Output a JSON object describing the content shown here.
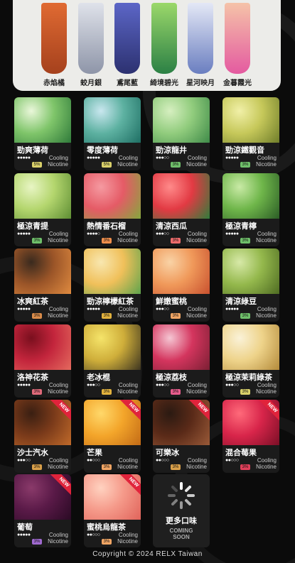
{
  "devices": [
    {
      "name": "赤焰橘",
      "colors": [
        "#e06a32",
        "#a5411d"
      ]
    },
    {
      "name": "蛟月銀",
      "colors": [
        "#dfe2ea",
        "#8e95a8"
      ]
    },
    {
      "name": "鳶尾藍",
      "colors": [
        "#5c66c7",
        "#2c3170"
      ]
    },
    {
      "name": "綺境碧光",
      "colors": [
        "#9bd86a",
        "#2b8045"
      ]
    },
    {
      "name": "星河映月",
      "colors": [
        "#e4e8f6",
        "#6a7ec0"
      ]
    },
    {
      "name": "金暮霞光",
      "colors": [
        "#f5c3a8",
        "#e45aa0"
      ]
    }
  ],
  "cooling_label": "Cooling",
  "nicotine_label": "Nicotine",
  "new_badge": "NEW",
  "flavors": [
    {
      "name": "勁爽薄荷",
      "cooling": 5,
      "nicotine": "5%",
      "pct_color": "#d9d06a",
      "img": [
        "#eaf7da",
        "#7fc56a",
        "#2f7a3a"
      ],
      "new": false
    },
    {
      "name": "零度薄荷",
      "cooling": 5,
      "nicotine": "5%",
      "pct_color": "#d9d06a",
      "img": [
        "#c9e7ef",
        "#5db1a1",
        "#1e6e63"
      ],
      "new": false
    },
    {
      "name": "勁涼龍井",
      "cooling": 3,
      "nicotine": "3%",
      "pct_color": "#6fbf6a",
      "img": [
        "#d6efc0",
        "#91cc7d",
        "#3e8a48"
      ],
      "new": false
    },
    {
      "name": "勁涼鐵觀音",
      "cooling": 5,
      "nicotine": "3%",
      "pct_color": "#6fbf6a",
      "img": [
        "#f1f0a8",
        "#c6c85a",
        "#6f7d2a"
      ],
      "new": false
    },
    {
      "name": "極涼青提",
      "cooling": 5,
      "nicotine": "3%",
      "pct_color": "#6fbf6a",
      "img": [
        "#e8f5c4",
        "#b4d66e",
        "#5d8d33"
      ],
      "new": false
    },
    {
      "name": "熱情番石榴",
      "cooling": 4,
      "nicotine": "3%",
      "pct_color": "#f08f4c",
      "img": [
        "#f59aa1",
        "#e55b66",
        "#84a83d"
      ],
      "new": false
    },
    {
      "name": "清涼西瓜",
      "cooling": 3,
      "nicotine": "3%",
      "pct_color": "#ef6c6c",
      "img": [
        "#ff8a8a",
        "#e23a43",
        "#2f7d3b"
      ],
      "new": false
    },
    {
      "name": "極涼青檸",
      "cooling": 5,
      "nicotine": "3%",
      "pct_color": "#6fbf6a",
      "img": [
        "#c9eaa6",
        "#6fb64a",
        "#2b5c26"
      ],
      "new": false
    },
    {
      "name": "冰爽紅茶",
      "cooling": 5,
      "nicotine": "3%",
      "pct_color": "#d98c4a",
      "img": [
        "#3a2a1e",
        "#9b5528",
        "#e08b40"
      ],
      "new": false
    },
    {
      "name": "勁涼檸檬紅茶",
      "cooling": 5,
      "nicotine": "3%",
      "pct_color": "#e2b23e",
      "img": [
        "#f8e7b0",
        "#f0c05a",
        "#5da34c"
      ],
      "new": false
    },
    {
      "name": "鮮嫩蜜桃",
      "cooling": 3,
      "nicotine": "3%",
      "pct_color": "#f0a564",
      "img": [
        "#f9d3a6",
        "#f0995a",
        "#c8502e"
      ],
      "new": false
    },
    {
      "name": "清涼綠豆",
      "cooling": 5,
      "nicotine": "3%",
      "pct_color": "#6fbf6a",
      "img": [
        "#d7e9a8",
        "#94b84c",
        "#4e6b22"
      ],
      "new": false
    },
    {
      "name": "洛神花茶",
      "cooling": 5,
      "nicotine": "3%",
      "pct_color": "#e06a7a",
      "img": [
        "#7a0f1e",
        "#c3253c",
        "#e46a5e"
      ],
      "new": false
    },
    {
      "name": "老冰棍",
      "cooling": 3,
      "nicotine": "3%",
      "pct_color": "#e2b23e",
      "img": [
        "#f5e46a",
        "#cfae3a",
        "#3c3420"
      ],
      "new": false
    },
    {
      "name": "極涼荔枝",
      "cooling": 3,
      "nicotine": "3%",
      "pct_color": "#e85c8c",
      "img": [
        "#f5c6d3",
        "#d4355e",
        "#7a1f33"
      ],
      "new": false
    },
    {
      "name": "極涼茉莉綠茶",
      "cooling": 3,
      "nicotine": "3%",
      "pct_color": "#d9d06a",
      "img": [
        "#faf2d8",
        "#eed38a",
        "#b38a3a"
      ],
      "new": false
    },
    {
      "name": "沙士汽水",
      "cooling": 3,
      "nicotine": "3%",
      "pct_color": "#d9a04a",
      "img": [
        "#3a1f12",
        "#7a3a1a",
        "#c06a2a"
      ],
      "new": true
    },
    {
      "name": "芒果",
      "cooling": 2,
      "nicotine": "3%",
      "pct_color": "#f0a564",
      "img": [
        "#ffd86a",
        "#f3a52a",
        "#c26a16"
      ],
      "new": true
    },
    {
      "name": "可樂冰",
      "cooling": 2,
      "nicotine": "3%",
      "pct_color": "#d9a04a",
      "img": [
        "#2b1a12",
        "#5a2a18",
        "#9a5a38"
      ],
      "new": true
    },
    {
      "name": "混合莓果",
      "cooling": 2,
      "nicotine": "3%",
      "pct_color": "#e0405a",
      "img": [
        "#ff6a7a",
        "#d8254a",
        "#7a0f26"
      ],
      "new": true
    },
    {
      "name": "葡萄",
      "cooling": 5,
      "nicotine": "3%",
      "pct_color": "#a06ad0",
      "img": [
        "#8a3a6a",
        "#5a1a48",
        "#2a0a24"
      ],
      "new": true
    },
    {
      "name": "蜜桃烏龍茶",
      "cooling": 2,
      "nicotine": "3%",
      "pct_color": "#f0a564",
      "img": [
        "#ffd2c0",
        "#f59a8a",
        "#e0635a"
      ],
      "new": true
    }
  ],
  "more": {
    "title": "更多口味",
    "coming": "COMING SOON"
  },
  "footer": "Copyright © 2024 RELX Taiwan"
}
